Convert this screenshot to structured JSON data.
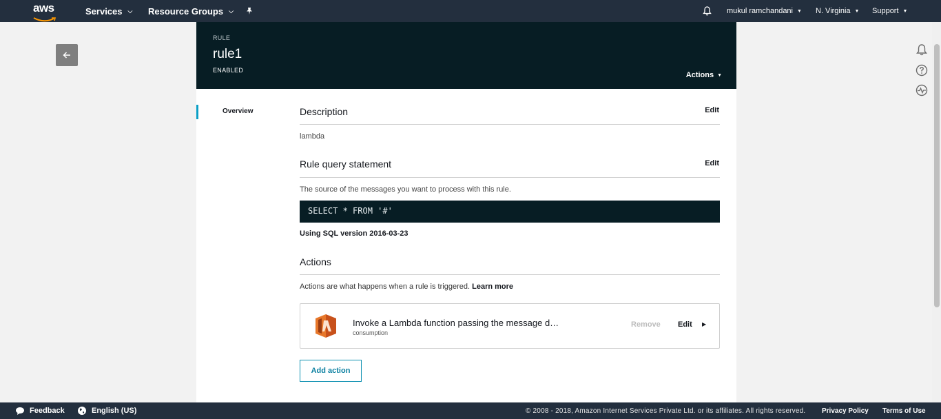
{
  "topnav": {
    "logo": "aws",
    "services": "Services",
    "resource_groups": "Resource Groups",
    "pin_icon": "pushpin-icon",
    "bell_icon": "bell-icon",
    "user": "mukul ramchandani",
    "region": "N. Virginia",
    "support": "Support"
  },
  "rail": {
    "icons": [
      "bell-icon",
      "help-icon",
      "activity-icon"
    ]
  },
  "header": {
    "kicker": "RULE",
    "title": "rule1",
    "status": "ENABLED",
    "actions": "Actions"
  },
  "sidenav": {
    "overview": "Overview"
  },
  "description": {
    "title": "Description",
    "edit": "Edit",
    "value": "lambda"
  },
  "query": {
    "title": "Rule query statement",
    "edit": "Edit",
    "help": "The source of the messages you want to process with this rule.",
    "statement": "SELECT * FROM '#'",
    "sql_version": "Using SQL version 2016-03-23"
  },
  "actions_section": {
    "title": "Actions",
    "help": "Actions are what happens when a rule is triggered.",
    "learn_more": "Learn more",
    "items": [
      {
        "title": "Invoke a Lambda function passing the message d…",
        "subtitle": "consumption",
        "remove": "Remove",
        "edit": "Edit"
      }
    ],
    "add_action": "Add action"
  },
  "footer": {
    "feedback": "Feedback",
    "language": "English (US)",
    "copyright": "© 2008 - 2018, Amazon Internet Services Private Ltd. or its affiliates. All rights reserved.",
    "privacy": "Privacy Policy",
    "terms": "Terms of Use"
  },
  "colors": {
    "nav_bg": "#232f3e",
    "header_bg": "#071d24",
    "accent": "#0a9fc6",
    "lambda_orange": "#e7772a"
  }
}
